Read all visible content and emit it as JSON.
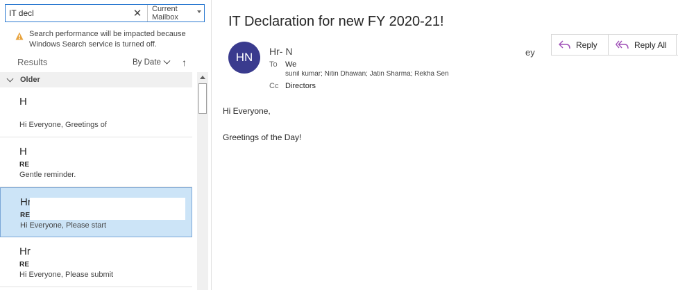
{
  "search": {
    "query": "IT decl",
    "scope": "Current Mailbox"
  },
  "warning": {
    "line1": "Search performance will be impacted because",
    "line2": "Windows Search service is turned off."
  },
  "results": {
    "label": "Results",
    "sort": "By Date"
  },
  "group": {
    "label": "Older"
  },
  "messages": [
    {
      "sender": "H",
      "subject": "",
      "preview": "Hi Everyone,  Greetings of"
    },
    {
      "sender": "H",
      "subject": "RE",
      "preview": "Gentle reminder."
    },
    {
      "sender": "Hr",
      "subject": "RE",
      "preview": "Hi Everyone,  Please start"
    },
    {
      "sender": "Hr",
      "subject": "RE",
      "preview": "Hi Everyone,  Please submit"
    }
  ],
  "reading": {
    "title": "IT Declaration for new FY 2020-21!",
    "avatar_initials": "HN",
    "from": "Hr- N",
    "from_cut": "ey",
    "to_label": "To",
    "to_value": "We",
    "to_line2": "sunil kumar; Nitin Dhawan; Jatin Sharma; Rekha   Sen",
    "cc_label": "Cc",
    "cc_value": "Directors",
    "body_greeting": "Hi Everyone,",
    "body_line": "Greetings of the Day!"
  },
  "actions": {
    "reply": "Reply",
    "reply_all": "Reply All"
  },
  "colors": {
    "accent": "#2b79d0",
    "selected_bg": "#cce4f7",
    "avatar_bg": "#3a3b8e",
    "reply_icon": "#a052b8"
  }
}
